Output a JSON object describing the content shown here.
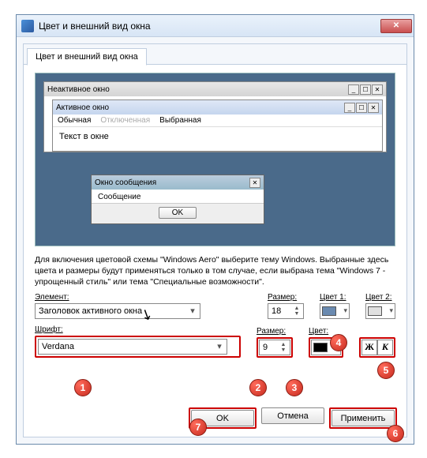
{
  "window": {
    "title": "Цвет и внешний вид окна",
    "close_glyph": "✕"
  },
  "tab": {
    "label": "Цвет и внешний вид окна"
  },
  "preview": {
    "inactive_title": "Неактивное окно",
    "active_title": "Активное окно",
    "menu_normal": "Обычная",
    "menu_disabled": "Отключенная",
    "menu_selected": "Выбранная",
    "body_text": "Текст в окне",
    "msg_title": "Окно сообщения",
    "msg_body": "Сообщение",
    "msg_ok": "OK",
    "winbtn_min": "_",
    "winbtn_max": "☐",
    "winbtn_close": "✕"
  },
  "help": "Для включения цветовой схемы \"Windows Aero\" выберите тему Windows. Выбранные здесь цвета и размеры будут применяться только в том случае, если выбрана тема \"Windows 7 - упрощенный стиль\" или тема \"Специальные возможности\".",
  "labels": {
    "element": "Элемент:",
    "size": "Размер:",
    "color1": "Цвет 1:",
    "color2": "Цвет 2:",
    "font": "Шрифт:",
    "fsize": "Размер:",
    "fcolor": "Цвет:"
  },
  "values": {
    "element": "Заголовок активного окна",
    "size": "18",
    "font": "Verdana",
    "fsize": "9",
    "color1": "#6a8ab0",
    "color2": "#e0e0e0",
    "fcolor": "#000000",
    "bold": "Ж",
    "italic": "К",
    "dropdown_glyph": "▾"
  },
  "buttons": {
    "ok": "OK",
    "cancel": "Отмена",
    "apply": "Применить"
  },
  "badges": [
    "1",
    "2",
    "3",
    "4",
    "5",
    "6",
    "7"
  ]
}
